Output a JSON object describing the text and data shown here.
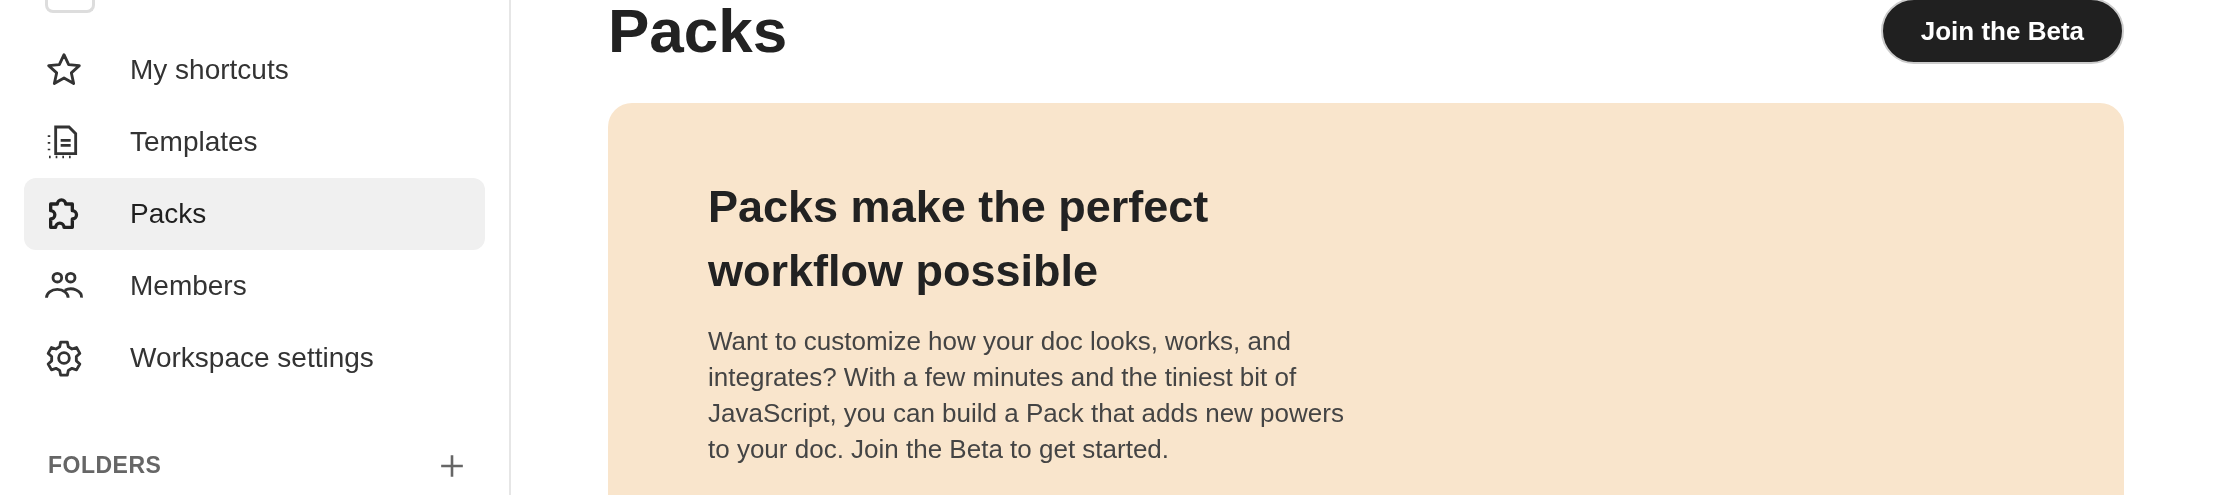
{
  "sidebar": {
    "items": [
      {
        "label": "My shortcuts",
        "selected": false
      },
      {
        "label": "Templates",
        "selected": false
      },
      {
        "label": "Packs",
        "selected": true
      },
      {
        "label": "Members",
        "selected": false
      },
      {
        "label": "Workspace settings",
        "selected": false
      }
    ],
    "folders_heading": "FOLDERS"
  },
  "page": {
    "title": "Packs",
    "join_button": "Join the Beta"
  },
  "banner": {
    "heading": "Packs make the perfect workflow possible",
    "body": "Want to customize how your doc looks, works, and integrates? With a few minutes and the tiniest bit of JavaScript, you can build a Pack that adds new powers to your doc. Join the Beta to get started."
  }
}
